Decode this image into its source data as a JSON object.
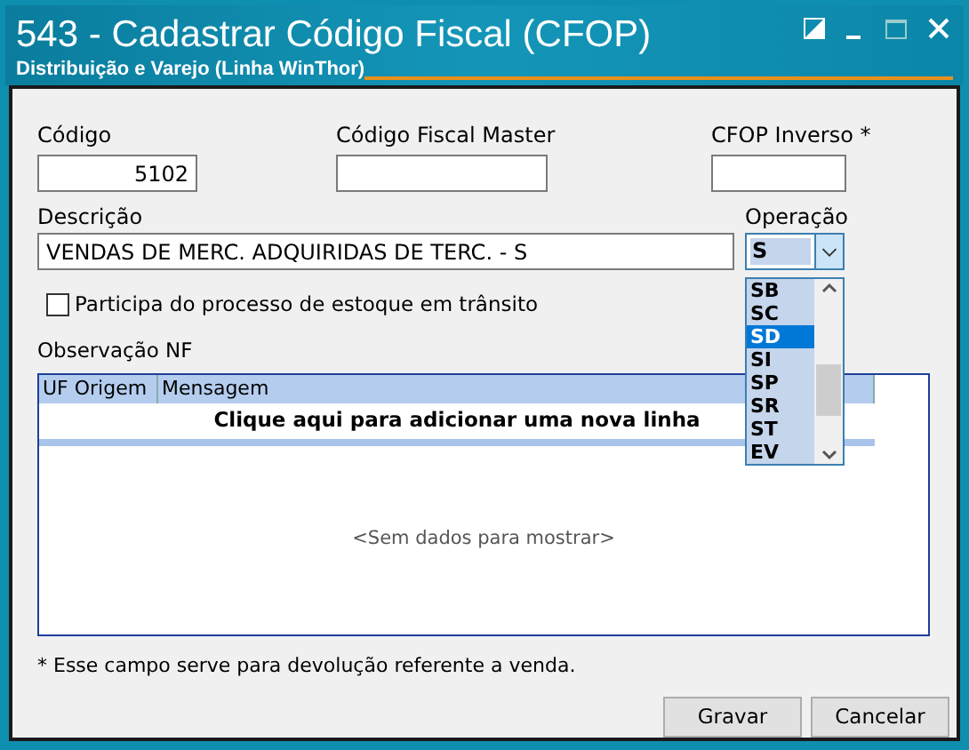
{
  "window": {
    "title": "543 - Cadastrar Código Fiscal (CFOP)",
    "subtitle": "Distribuição e Varejo (Linha WinThor)"
  },
  "fields": {
    "codigo": {
      "label": "Código",
      "value": "5102"
    },
    "master": {
      "label": "Código Fiscal Master"
    },
    "inverso": {
      "label": "CFOP Inverso *"
    },
    "descricao": {
      "label": "Descrição",
      "value": "VENDAS DE MERC. ADQUIRIDAS DE TERC. - S"
    },
    "operacao": {
      "label": "Operação",
      "value": "S",
      "expanded": true,
      "options": [
        {
          "label": "SB",
          "selected": false
        },
        {
          "label": "SC",
          "selected": false
        },
        {
          "label": "SD",
          "selected": true
        },
        {
          "label": "SI",
          "selected": false
        },
        {
          "label": "SP",
          "selected": false
        },
        {
          "label": "SR",
          "selected": false
        },
        {
          "label": "ST",
          "selected": false
        },
        {
          "label": "EV",
          "selected": false
        }
      ]
    }
  },
  "transit_checkbox": {
    "label": "Participa do processo de estoque em trânsito",
    "checked": false
  },
  "grid": {
    "label": "Observação NF",
    "columns": [
      "UF Origem",
      "Mensagem"
    ],
    "new_row": "Clique aqui para adicionar uma nova linha",
    "empty": "<Sem dados para mostrar>"
  },
  "footnote": "* Esse campo serve para devolução referente a venda.",
  "buttons": [
    "Gravar",
    "Cancelar"
  ]
}
